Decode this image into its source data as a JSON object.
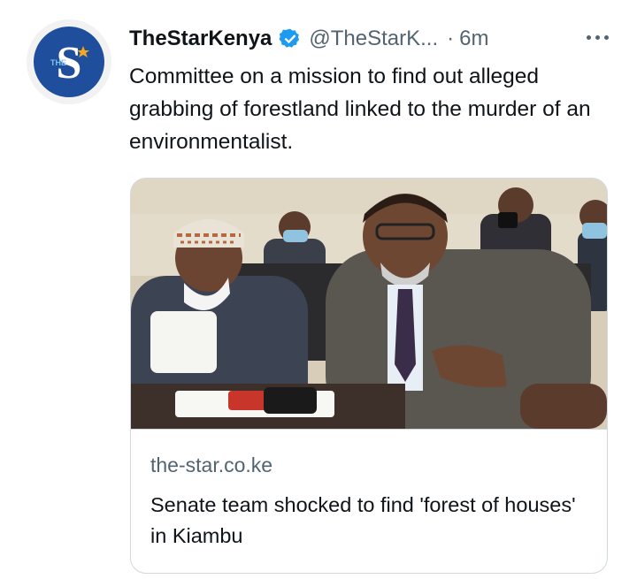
{
  "tweet": {
    "author_name": "TheStarKenya",
    "author_handle": "@TheStarK...",
    "separator": "·",
    "time": "6m",
    "text": "Committee on a mission to find out alleged grabbing of forestland linked to the murder of an environmentalist.",
    "avatar_letter": "S",
    "avatar_small_text": "THE"
  },
  "card": {
    "domain": "the-star.co.ke",
    "title": "Senate team shocked to find 'forest of houses' in Kiambu"
  },
  "icons": {
    "avatar": "thestar-logo-icon",
    "verified": "verified-badge-icon",
    "more": "more-options-icon"
  },
  "colors": {
    "verified_blue": "#1d9bf0",
    "secondary_text": "#536471",
    "border": "#cfd9de",
    "logo_blue": "#1f4e9c"
  }
}
